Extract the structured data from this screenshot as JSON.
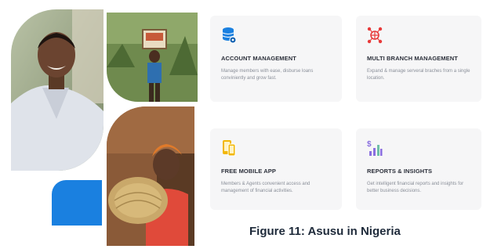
{
  "features": [
    {
      "icon": "database-gear-icon",
      "icon_color": "#1a80e0",
      "title": "ACCOUNT MANAGEMENT",
      "description": "Manage members with ease, disburse loans conviniently and grow fast."
    },
    {
      "icon": "network-globe-icon",
      "icon_color": "#e83a3a",
      "title": "MULTI BRANCH MANAGEMENT",
      "description": "Expand & manage serveral braches from a single location."
    },
    {
      "icon": "mobile-devices-icon",
      "icon_color": "#f2b705",
      "title": "FREE MOBILE APP",
      "description": "Members & Agents convenient access and management of financial activities."
    },
    {
      "icon": "dollar-bar-chart-icon",
      "icon_color": "#8a6fe0",
      "title": "REPORTS & INSIGHTS",
      "description": "Get intelligent financial reports and insights for better business decisions."
    }
  ],
  "caption": "Figure 11: Asusu in Nigeria",
  "colors": {
    "accent_blue": "#1a80e0",
    "card_background": "#f6f6f7"
  }
}
